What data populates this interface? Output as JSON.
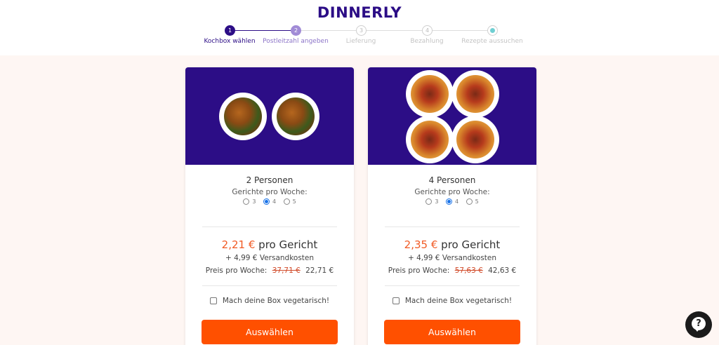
{
  "brand": {
    "logo_text": "DINNERLY",
    "color": "#2c0d86"
  },
  "stepper": {
    "steps": [
      {
        "number": "1",
        "label": "Kochbox wählen",
        "state": "done"
      },
      {
        "number": "2",
        "label": "Postleitzahl angeben",
        "state": "active"
      },
      {
        "number": "3",
        "label": "Lieferung",
        "state": "todo"
      },
      {
        "number": "4",
        "label": "Bezahlung",
        "state": "todo"
      },
      {
        "number": "",
        "label": "Rezepte aussuchen",
        "state": "final"
      }
    ]
  },
  "plans": [
    {
      "image": "chicken-plates",
      "title": "2 Personen",
      "subtitle": "Gerichte pro Woche:",
      "options": [
        {
          "value": "3",
          "checked": false
        },
        {
          "value": "4",
          "checked": true
        },
        {
          "value": "5",
          "checked": false
        }
      ],
      "price_amount": "2,21 €",
      "price_suffix": "pro Gericht",
      "shipping": "+ 4,99 € Versandkosten",
      "weekly_label": "Preis pro Woche:",
      "weekly_old": "37,71 €",
      "weekly_new": "22,71 €",
      "veg_label": "Mach deine Box vegetarisch!",
      "button_label": "Auswählen"
    },
    {
      "image": "pasta-plates",
      "title": "4 Personen",
      "subtitle": "Gerichte pro Woche:",
      "options": [
        {
          "value": "3",
          "checked": false
        },
        {
          "value": "4",
          "checked": true
        },
        {
          "value": "5",
          "checked": false
        }
      ],
      "price_amount": "2,35 €",
      "price_suffix": "pro Gericht",
      "shipping": "+ 4,99 € Versandkosten",
      "weekly_label": "Preis pro Woche:",
      "weekly_old": "57,63 €",
      "weekly_new": "42,63 €",
      "veg_label": "Mach deine Box vegetarisch!",
      "button_label": "Auswählen"
    }
  ],
  "colors": {
    "accent": "#ff5000",
    "price": "#f15a24",
    "background": "#fef6f3"
  },
  "help": {
    "icon": "help-chat-icon",
    "glyph": "?"
  }
}
